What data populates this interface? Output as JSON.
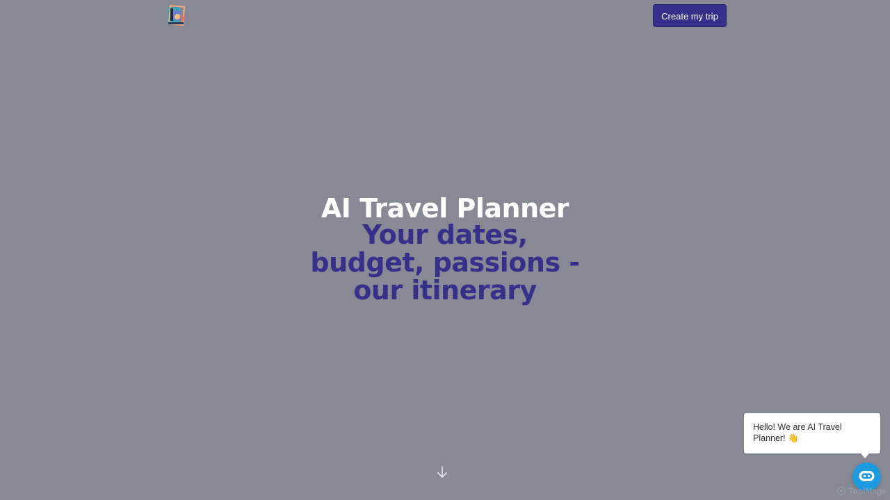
{
  "header": {
    "logo_icon": "abstract-colorful-logo-icon",
    "cta_label": "Create my trip"
  },
  "hero": {
    "title": "AI Travel Planner",
    "subtitle": "Your dates, budget, passions - our itinerary"
  },
  "scroll": {
    "icon": "arrow-down-icon"
  },
  "chat": {
    "greeting": "Hello! We are AI Travel Planner! 👋",
    "launcher_icon": "chatbot-icon"
  },
  "watermark": {
    "text": "ToolMage"
  },
  "colors": {
    "background": "#878a94",
    "accent": "#35308a",
    "chat_launcher": "#1b9be0"
  }
}
